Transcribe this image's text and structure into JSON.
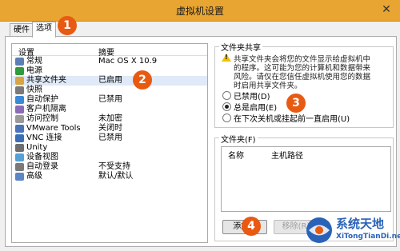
{
  "window": {
    "title": "虚拟机设置",
    "close_label": "✕"
  },
  "tabs": [
    {
      "label": "硬件",
      "active": false
    },
    {
      "label": "选项",
      "active": true
    }
  ],
  "settings": {
    "columns": [
      "设置",
      "摘要"
    ],
    "rows": [
      {
        "name": "常规",
        "summary": "Mac OS X 10.9",
        "icon": "general-icon"
      },
      {
        "name": "电源",
        "summary": "",
        "icon": "power-icon"
      },
      {
        "name": "共享文件夹",
        "summary": "已启用",
        "icon": "shared-folder-icon"
      },
      {
        "name": "快照",
        "summary": "",
        "icon": "snapshot-icon"
      },
      {
        "name": "自动保护",
        "summary": "已禁用",
        "icon": "autoprotect-icon"
      },
      {
        "name": "客户机隔离",
        "summary": "",
        "icon": "guest-isolation-icon"
      },
      {
        "name": "访问控制",
        "summary": "未加密",
        "icon": "access-control-icon"
      },
      {
        "name": "VMware Tools",
        "summary": "关闭时",
        "icon": "vmware-tools-icon"
      },
      {
        "name": "VNC 连接",
        "summary": "已禁用",
        "icon": "vnc-icon"
      },
      {
        "name": "Unity",
        "summary": "",
        "icon": "unity-icon"
      },
      {
        "name": "设备视图",
        "summary": "",
        "icon": "device-view-icon"
      },
      {
        "name": "自动登录",
        "summary": "不受支持",
        "icon": "autologin-icon"
      },
      {
        "name": "高级",
        "summary": "默认/默认",
        "icon": "advanced-icon"
      }
    ]
  },
  "sharing": {
    "group_title": "文件夹共享",
    "warning_lines": [
      "共享文件夹会将您的文件显示给虚拟机中",
      "的程序。这可能为您的计算机和数据带来",
      "风险。请仅在您信任虚拟机使用您的数据",
      "时启用共享文件夹。"
    ],
    "options": [
      {
        "label": "已禁用(D)",
        "selected": false
      },
      {
        "label": "总是启用(E)",
        "selected": true
      },
      {
        "label": "在下次关机或挂起前一直启用(U)",
        "selected": false
      }
    ]
  },
  "folders": {
    "group_title": "文件夹(F)",
    "columns": [
      "名称",
      "主机路径"
    ],
    "add_button": "添加...",
    "remove_button": "移除(R)"
  },
  "callouts": [
    "1",
    "2",
    "3",
    "4"
  ],
  "watermark": {
    "cn": "系统天地",
    "en": "XiTongTianDi.net"
  },
  "colors": {
    "titlebar": "#e8a531",
    "callout": "#e85a12",
    "selection": "#dfe9f7"
  }
}
